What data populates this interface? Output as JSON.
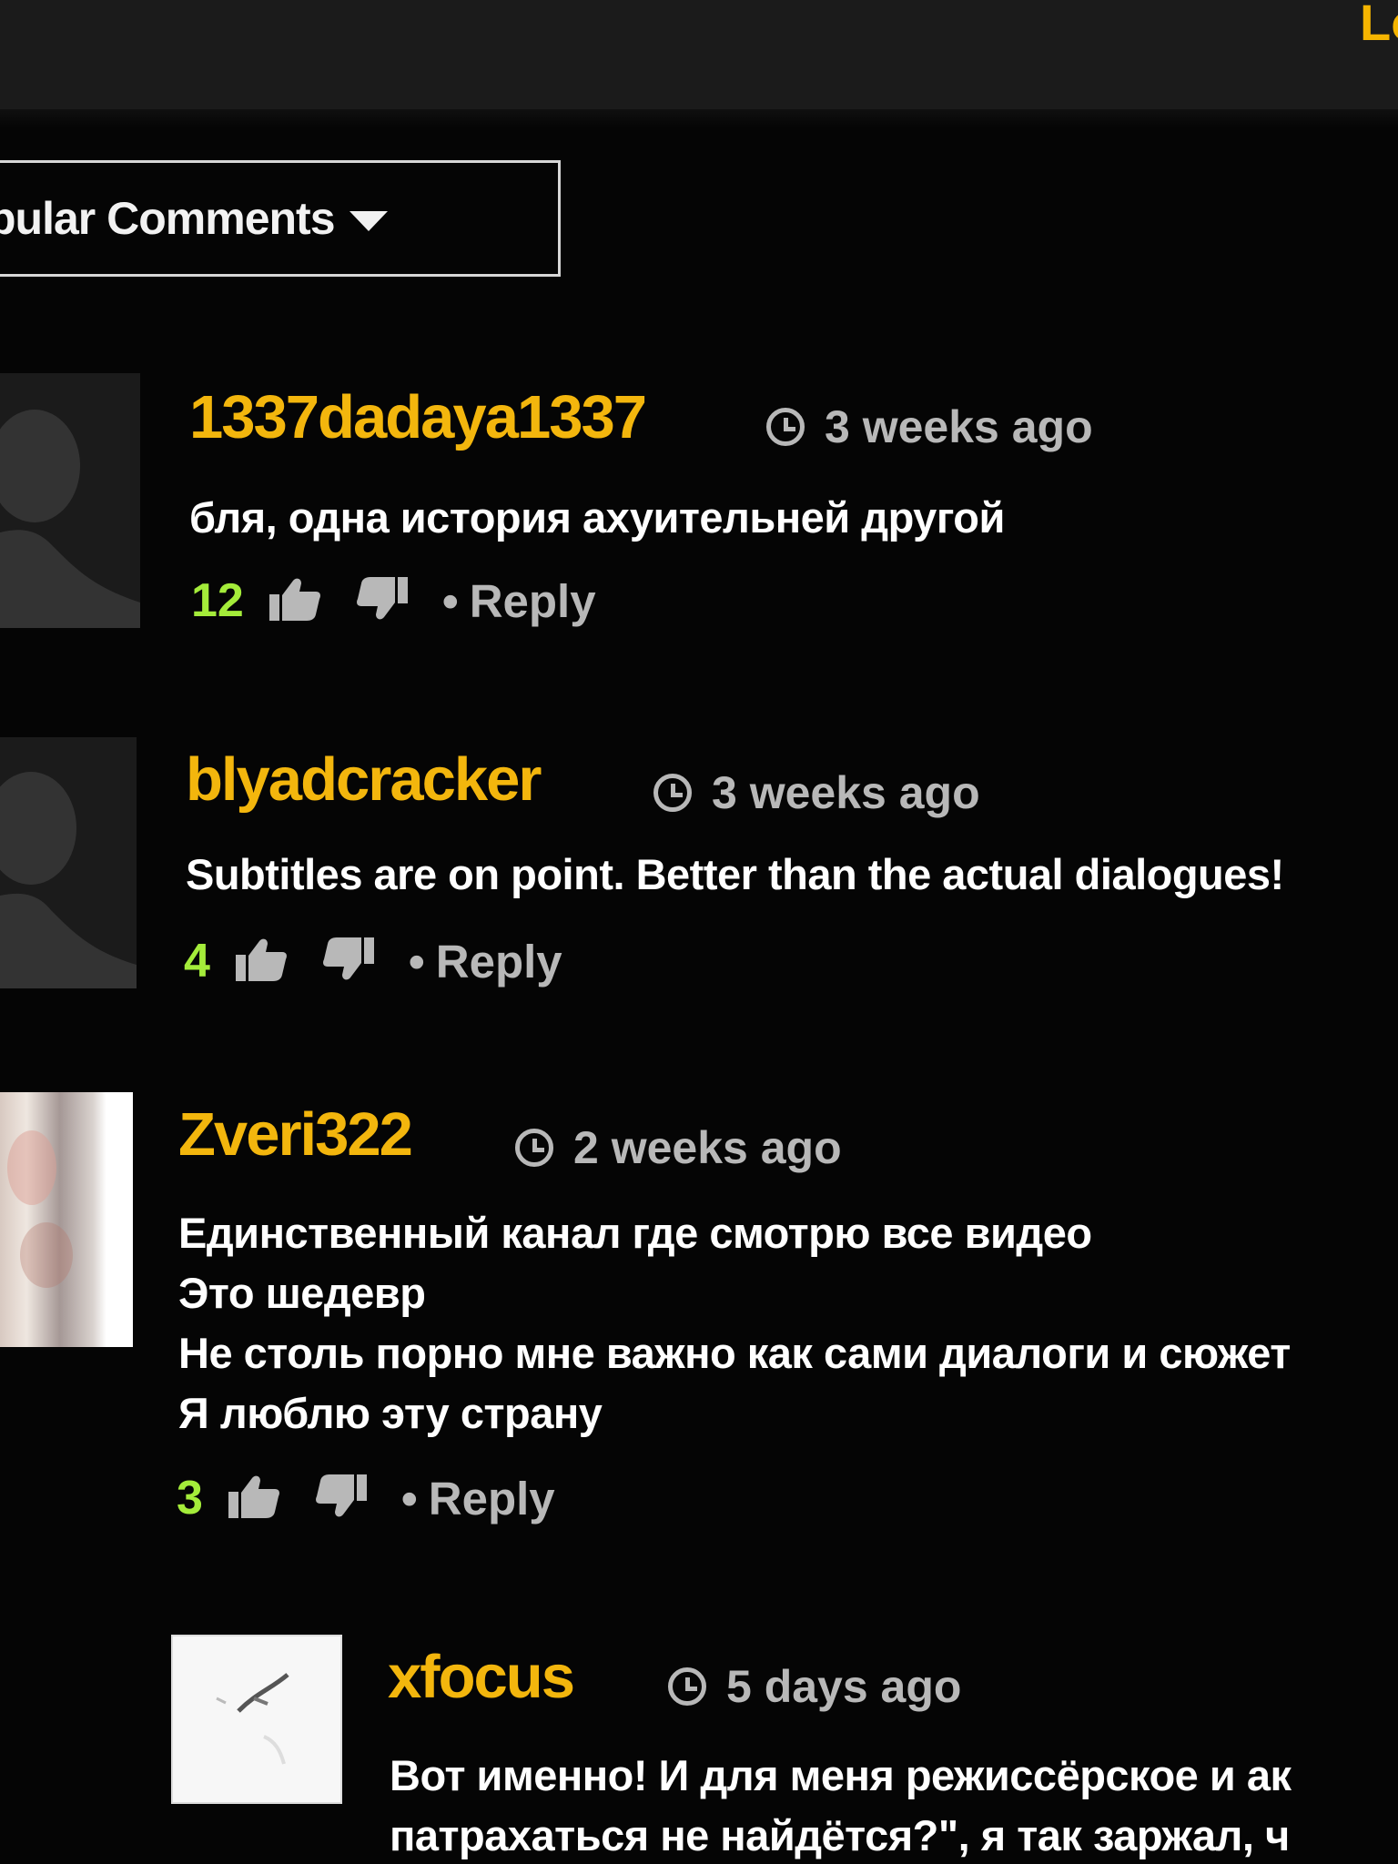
{
  "header": {
    "right_link_fragment": "Lo"
  },
  "sort": {
    "label": "pular Comments"
  },
  "comments": [
    {
      "username": "1337dadaya1337",
      "time": "3 weeks ago",
      "lines": [
        "бля, одна история ахуительней другой"
      ],
      "likes": "12",
      "reply": "Reply"
    },
    {
      "username": "blyadcracker",
      "time": "3 weeks ago",
      "lines": [
        "Subtitles are on point. Better than the actual dialogues!"
      ],
      "likes": "4",
      "reply": "Reply"
    },
    {
      "username": "Zveri322",
      "time": "2 weeks ago",
      "lines": [
        "Единственный канал где смотрю все видео",
        "Это шедевр",
        "Не столь порно мне важно как сами диалоги и сюжет",
        "Я люблю эту страну"
      ],
      "likes": "3",
      "reply": "Reply"
    },
    {
      "username": "xfocus",
      "time": "5 days ago",
      "lines": [
        "Вот именно! И для меня режиссёрское и ак",
        "патрахаться не найдётся?\", я так заржал, ч"
      ]
    }
  ],
  "colors": {
    "background": "#050505",
    "username": "#f3b60d",
    "meta": "#b8b8b8",
    "likes": "#a4ec3a",
    "text": "#ffffff"
  },
  "icons": [
    "clock-icon",
    "thumbs-up-icon",
    "thumbs-down-icon",
    "caret-down-icon"
  ]
}
